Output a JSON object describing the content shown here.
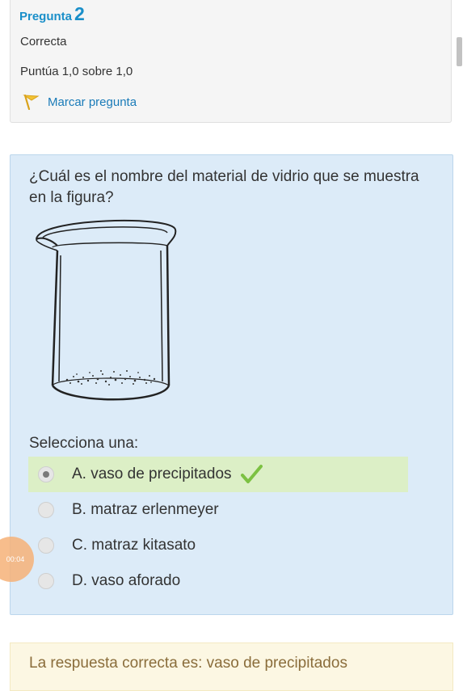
{
  "info": {
    "question_label": "Pregunta",
    "question_number": "2",
    "state": "Correcta",
    "grade": "Puntúa 1,0 sobre 1,0",
    "flag_label": "Marcar pregunta"
  },
  "question": {
    "text": "¿Cuál es el nombre del material de vidrio que se muestra en la figura?",
    "prompt": "Selecciona una:",
    "options": [
      {
        "label": "A. vaso de precipitados",
        "selected": true,
        "correct": true
      },
      {
        "label": "B. matraz erlenmeyer",
        "selected": false
      },
      {
        "label": "C. matraz kitasato",
        "selected": false
      },
      {
        "label": "D. vaso aforado",
        "selected": false
      }
    ]
  },
  "timer": "00:04",
  "feedback": {
    "text": "La respuesta correcta es: vaso de precipitados"
  },
  "colors": {
    "link": "#1a8fc9",
    "question_bg": "#dcebf8",
    "selected_bg": "#dcefc6",
    "check": "#7cc142",
    "feedback_bg": "#fcf7e3",
    "feedback_text": "#8a6d3b"
  },
  "icons": {
    "flag": "flag-icon",
    "check": "checkmark-icon",
    "figure": "beaker-icon"
  }
}
